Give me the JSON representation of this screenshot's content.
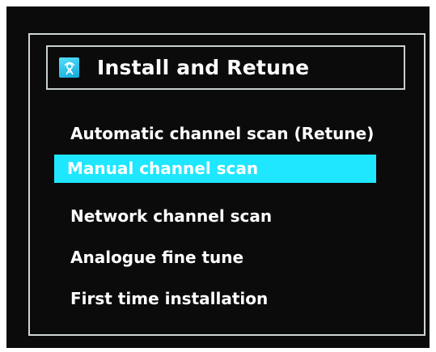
{
  "menu": {
    "title": "Install and Retune",
    "title_icon": "antenna-icon",
    "accent_color": "#1ee7ff",
    "items": [
      {
        "label": "Automatic channel scan (Retune)",
        "selected": false
      },
      {
        "label": "Manual channel scan",
        "selected": true
      },
      {
        "label": "Network channel scan",
        "selected": false
      },
      {
        "label": "Analogue fine tune",
        "selected": false
      },
      {
        "label": "First time installation",
        "selected": false
      }
    ]
  }
}
